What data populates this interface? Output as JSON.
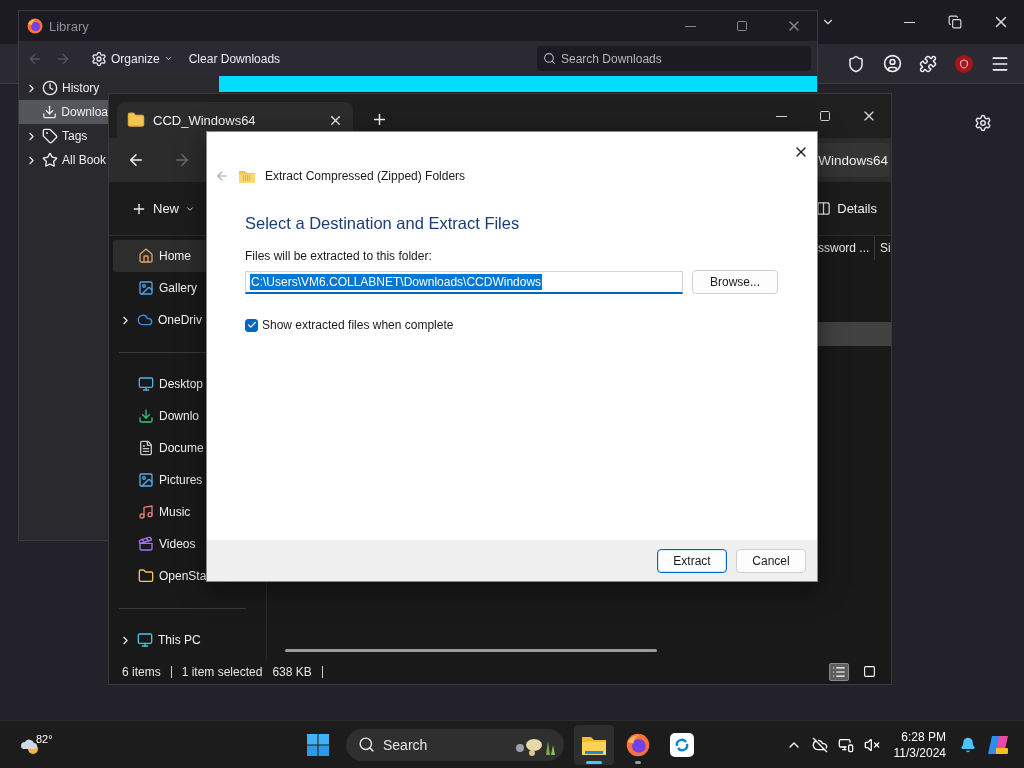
{
  "library": {
    "title": "Library",
    "toolbar": {
      "organize": "Organize",
      "clear": "Clear Downloads",
      "search_placeholder": "Search Downloads"
    },
    "sidebar": [
      {
        "label": "History",
        "expandable": true,
        "selected": false
      },
      {
        "label": "Downloa",
        "expandable": false,
        "selected": true
      },
      {
        "label": "Tags",
        "expandable": true,
        "selected": false
      },
      {
        "label": "All Book",
        "expandable": true,
        "selected": false
      }
    ],
    "download_rows": [
      {
        "selected": true
      }
    ]
  },
  "explorer": {
    "tab": "CCD_Windows64",
    "address": "Windows64",
    "commands": {
      "new": "New",
      "details": "Details"
    },
    "columns": [
      "ssword ...",
      "Si"
    ],
    "sidebar_groups": [
      [
        {
          "label": "Home",
          "expandable": false,
          "selected": true
        },
        {
          "label": "Gallery",
          "expandable": false,
          "selected": false
        },
        {
          "label": "OneDriv",
          "expandable": true,
          "selected": false
        }
      ],
      [
        {
          "label": "Desktop",
          "expandable": false,
          "selected": false
        },
        {
          "label": "Downlo",
          "expandable": false,
          "selected": false
        },
        {
          "label": "Docume",
          "expandable": false,
          "selected": false
        },
        {
          "label": "Pictures",
          "expandable": false,
          "selected": false
        },
        {
          "label": "Music",
          "expandable": false,
          "selected": false
        },
        {
          "label": "Videos",
          "expandable": false,
          "selected": false
        },
        {
          "label": "OpenSta",
          "expandable": false,
          "selected": false
        }
      ],
      [
        {
          "label": "This PC",
          "expandable": true,
          "selected": false
        }
      ]
    ],
    "rows": [
      {
        "selected": true
      }
    ],
    "status": {
      "count": "6 items",
      "selection": "1 item selected",
      "size": "638 KB"
    },
    "views": [
      {
        "kind": "details",
        "selected": true
      },
      {
        "kind": "tiles",
        "selected": false
      }
    ]
  },
  "dialog": {
    "title": "Extract Compressed (Zipped) Folders",
    "heading": "Select a Destination and Extract Files",
    "field_label": "Files will be extracted to this folder:",
    "path": "C:\\Users\\VM6.COLLABNET\\Downloads\\CCDWindows",
    "browse": "Browse...",
    "checkbox": {
      "label": "Show extracted files when complete",
      "checked": true
    },
    "buttons": [
      {
        "label": "Extract",
        "default": true
      },
      {
        "label": "Cancel",
        "default": false
      }
    ]
  },
  "taskbar": {
    "weather": "82°",
    "search_label": "Search",
    "apps": [
      {
        "kind": "explorer",
        "open": true,
        "active": true
      },
      {
        "kind": "firefox",
        "open": true,
        "active": false
      },
      {
        "kind": "sync",
        "open": false,
        "active": false
      }
    ],
    "time": "6:28 PM",
    "date": "11/3/2024"
  }
}
